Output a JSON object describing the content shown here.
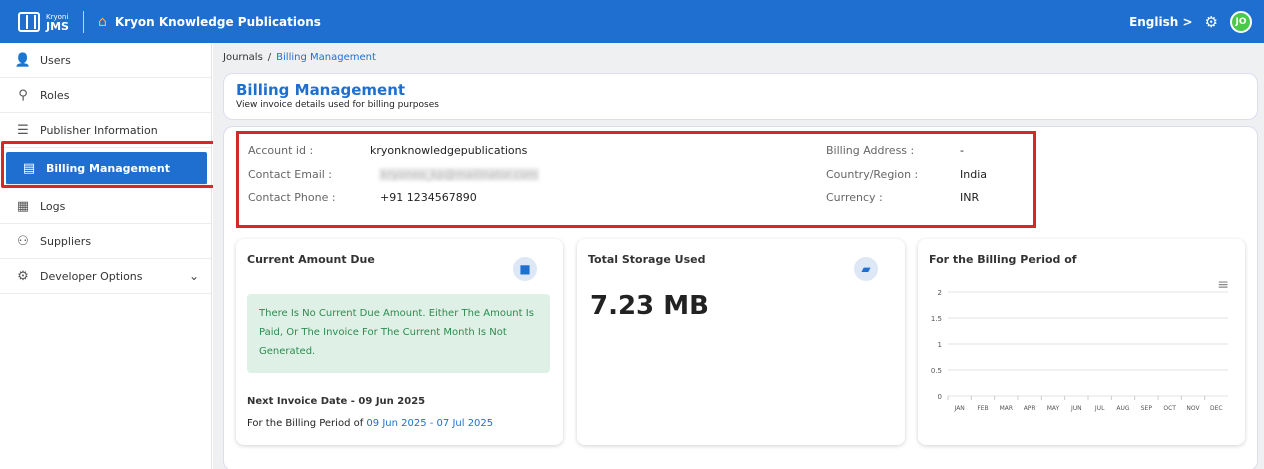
{
  "topbar": {
    "logo_small": "Kryoni",
    "logo_big": "JMS",
    "org_name": "Kryon Knowledge Publications",
    "language": "English >",
    "avatar_initials": "JO"
  },
  "sidebar": {
    "items": [
      {
        "label": "Users",
        "icon": "user-icon"
      },
      {
        "label": "Roles",
        "icon": "roles-icon"
      },
      {
        "label": "Publisher Information",
        "icon": "sliders-icon"
      },
      {
        "label": "Billing Management",
        "icon": "billing-icon"
      },
      {
        "label": "Logs",
        "icon": "logs-icon"
      },
      {
        "label": "Suppliers",
        "icon": "suppliers-icon"
      },
      {
        "label": "Developer Options",
        "icon": "gear-icon"
      }
    ]
  },
  "breadcrumb": {
    "root": "Journals",
    "sep": "/",
    "current": "Billing Management"
  },
  "header": {
    "title": "Billing Management",
    "subtitle": "View invoice details used for billing purposes"
  },
  "account": {
    "account_id_label": "Account id :",
    "account_id": "kryonknowledgepublications",
    "email_label": "Contact Email :",
    "email": "kryoneo_kp@mailinator.com",
    "phone_label": "Contact Phone :",
    "phone": "+91 1234567890",
    "address_label": "Billing Address :",
    "address": "-",
    "country_label": "Country/Region :",
    "country": "India",
    "currency_label": "Currency :",
    "currency": "INR"
  },
  "due_card": {
    "title": "Current Amount Due",
    "notice": "There Is No Current Due Amount. Either The Amount Is Paid, Or The Invoice For The Current Month Is Not Generated.",
    "next_invoice": "Next Invoice Date -  09 Jun 2025",
    "period_label": "For the Billing Period of",
    "period_range": "09 Jun 2025 - 07 Jul 2025"
  },
  "storage_card": {
    "title": "Total Storage Used",
    "value": "7.23 MB"
  },
  "chart_card": {
    "title": "For the Billing Period of"
  },
  "chart_data": {
    "type": "bar",
    "categories": [
      "JAN",
      "FEB",
      "MAR",
      "APR",
      "MAY",
      "JUN",
      "JUL",
      "AUG",
      "SEP",
      "OCT",
      "NOV",
      "DEC"
    ],
    "y_ticks": [
      "0",
      "0.5",
      "1",
      "1.5",
      "2"
    ],
    "values": [
      0,
      0,
      0,
      0,
      0,
      0,
      0,
      0,
      0,
      0,
      0,
      0
    ],
    "ylim": [
      0,
      2
    ],
    "grid": true
  }
}
